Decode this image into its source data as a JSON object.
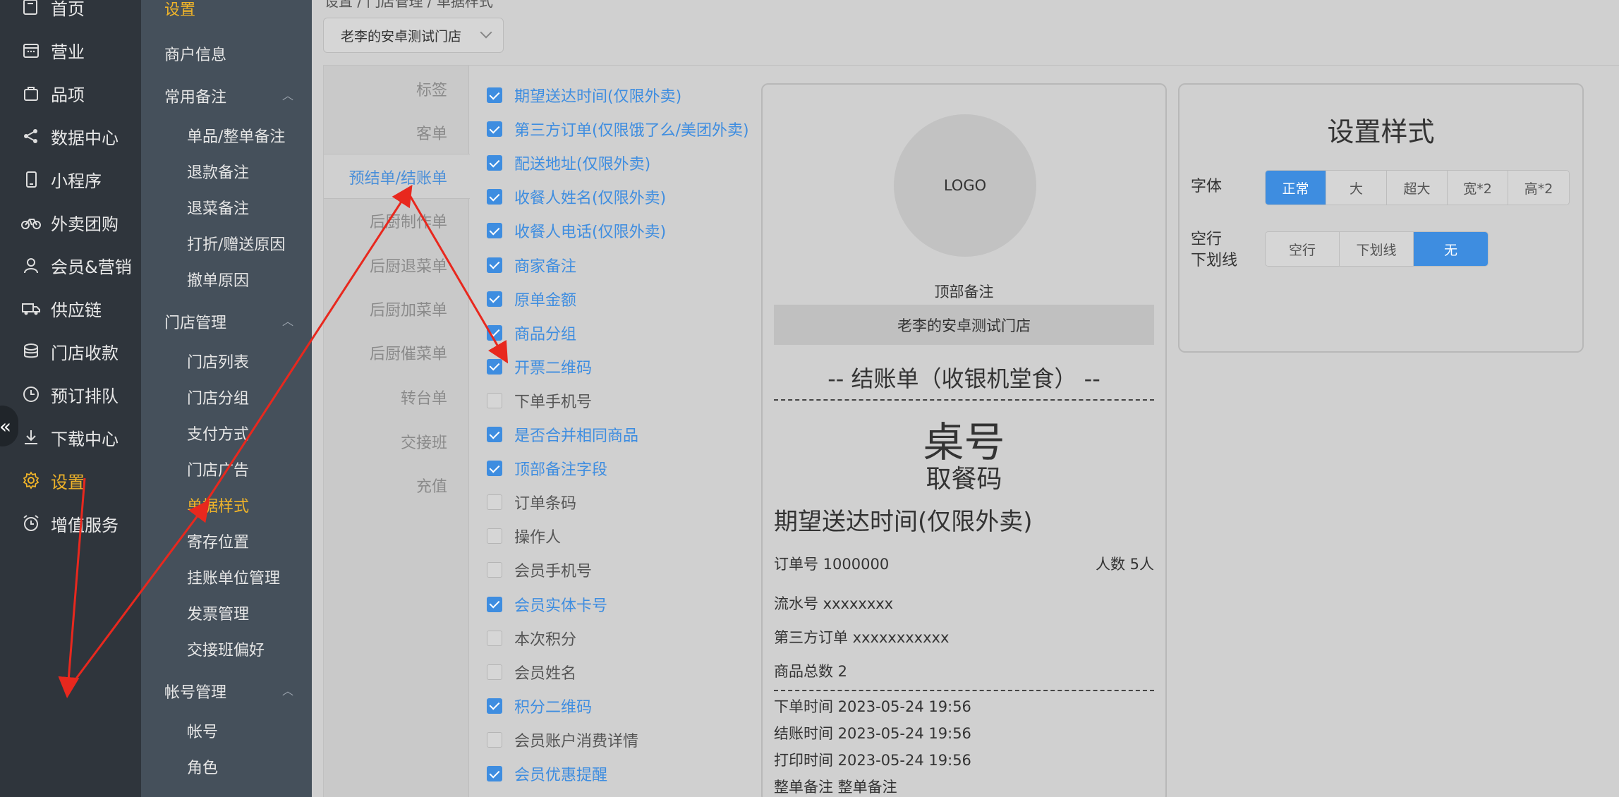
{
  "nav": {
    "items": [
      {
        "label": "首页",
        "icon": "home-icon"
      },
      {
        "label": "营业",
        "icon": "calendar-icon"
      },
      {
        "label": "品项",
        "icon": "bag-icon"
      },
      {
        "label": "数据中心",
        "icon": "share-icon"
      },
      {
        "label": "小程序",
        "icon": "phone-icon"
      },
      {
        "label": "外卖团购",
        "icon": "bike-icon"
      },
      {
        "label": "会员&营销",
        "icon": "user-icon"
      },
      {
        "label": "供应链",
        "icon": "truck-icon"
      },
      {
        "label": "门店收款",
        "icon": "coins-icon"
      },
      {
        "label": "预订排队",
        "icon": "clock-icon"
      },
      {
        "label": "下载中心",
        "icon": "download-icon"
      },
      {
        "label": "设置",
        "icon": "gear-icon"
      },
      {
        "label": "增值服务",
        "icon": "alarm-icon"
      }
    ],
    "active_label": "设置",
    "collapse_glyph": "«"
  },
  "subnav": {
    "title": "设置",
    "merchant_info": "商户信息",
    "group_notes": "常用备注",
    "notes_items": [
      "单品/整单备注",
      "退款备注",
      "退菜备注",
      "打折/赠送原因",
      "撤单原因"
    ],
    "group_store": "门店管理",
    "store_items": [
      "门店列表",
      "门店分组",
      "支付方式",
      "门店广告",
      "单据样式",
      "寄存位置",
      "挂账单位管理",
      "发票管理",
      "交接班偏好"
    ],
    "group_account": "帐号管理",
    "account_items": [
      "帐号",
      "角色"
    ],
    "active_item": "单据样式"
  },
  "breadcrumb": "设置 / 门店管理 / 单据样式",
  "store_select": {
    "value": "老李的安卓测试门店"
  },
  "tabs": [
    "标签",
    "客单",
    "预结单/结账单",
    "后厨制作单",
    "后厨退菜单",
    "后厨加菜单",
    "后厨催菜单",
    "转台单",
    "交接班",
    "充值"
  ],
  "active_tab": "预结单/结账单",
  "fields": [
    {
      "label": "期望送达时间(仅限外卖)",
      "checked": true
    },
    {
      "label": "第三方订单(仅限饿了么/美团外卖)",
      "checked": true
    },
    {
      "label": "配送地址(仅限外卖)",
      "checked": true
    },
    {
      "label": "收餐人姓名(仅限外卖)",
      "checked": true
    },
    {
      "label": "收餐人电话(仅限外卖)",
      "checked": true
    },
    {
      "label": "商家备注",
      "checked": true
    },
    {
      "label": "原单金额",
      "checked": true
    },
    {
      "label": "商品分组",
      "checked": true
    },
    {
      "label": "开票二维码",
      "checked": true
    },
    {
      "label": "下单手机号",
      "checked": false
    },
    {
      "label": "是否合并相同商品",
      "checked": true
    },
    {
      "label": "顶部备注字段",
      "checked": true
    },
    {
      "label": "订单条码",
      "checked": false
    },
    {
      "label": "操作人",
      "checked": false
    },
    {
      "label": "会员手机号",
      "checked": false
    },
    {
      "label": "会员实体卡号",
      "checked": true
    },
    {
      "label": "本次积分",
      "checked": false
    },
    {
      "label": "会员姓名",
      "checked": false
    },
    {
      "label": "积分二维码",
      "checked": true
    },
    {
      "label": "会员账户消费详情",
      "checked": false
    },
    {
      "label": "会员优惠提醒",
      "checked": true
    }
  ],
  "preview": {
    "logo": "LOGO",
    "top_note": "顶部备注",
    "store_name": "老李的安卓测试门店",
    "receipt_title": "-- 结账单（收银机堂食） --",
    "table_no": "桌号",
    "pickup_code": "取餐码",
    "expected_time": "期望送达时间(仅限外卖)",
    "order_no": "订单号 1000000",
    "people": "人数 5人",
    "serial_no": "流水号 xxxxxxxx",
    "third_party": "第三方订单 xxxxxxxxxxx",
    "total_items": "商品总数 2",
    "order_time": "下单时间 2023-05-24 19:56",
    "checkout_time": "结账时间 2023-05-24 19:56",
    "print_time": "打印时间 2023-05-24 19:56",
    "order_note": "整单备注 整单备注"
  },
  "style_panel": {
    "title": "设置样式",
    "font_label": "字体",
    "font_options": [
      "正常",
      "大",
      "超大",
      "宽*2",
      "高*2"
    ],
    "font_selected": "正常",
    "blank_label_1": "空行",
    "blank_label_2": "下划线",
    "blank_options": [
      "空行",
      "下划线",
      "无"
    ],
    "blank_selected": "无"
  },
  "colors": {
    "accent": "#3e8de0",
    "active_nav": "#f0b429",
    "annotation": "#e8281e"
  }
}
